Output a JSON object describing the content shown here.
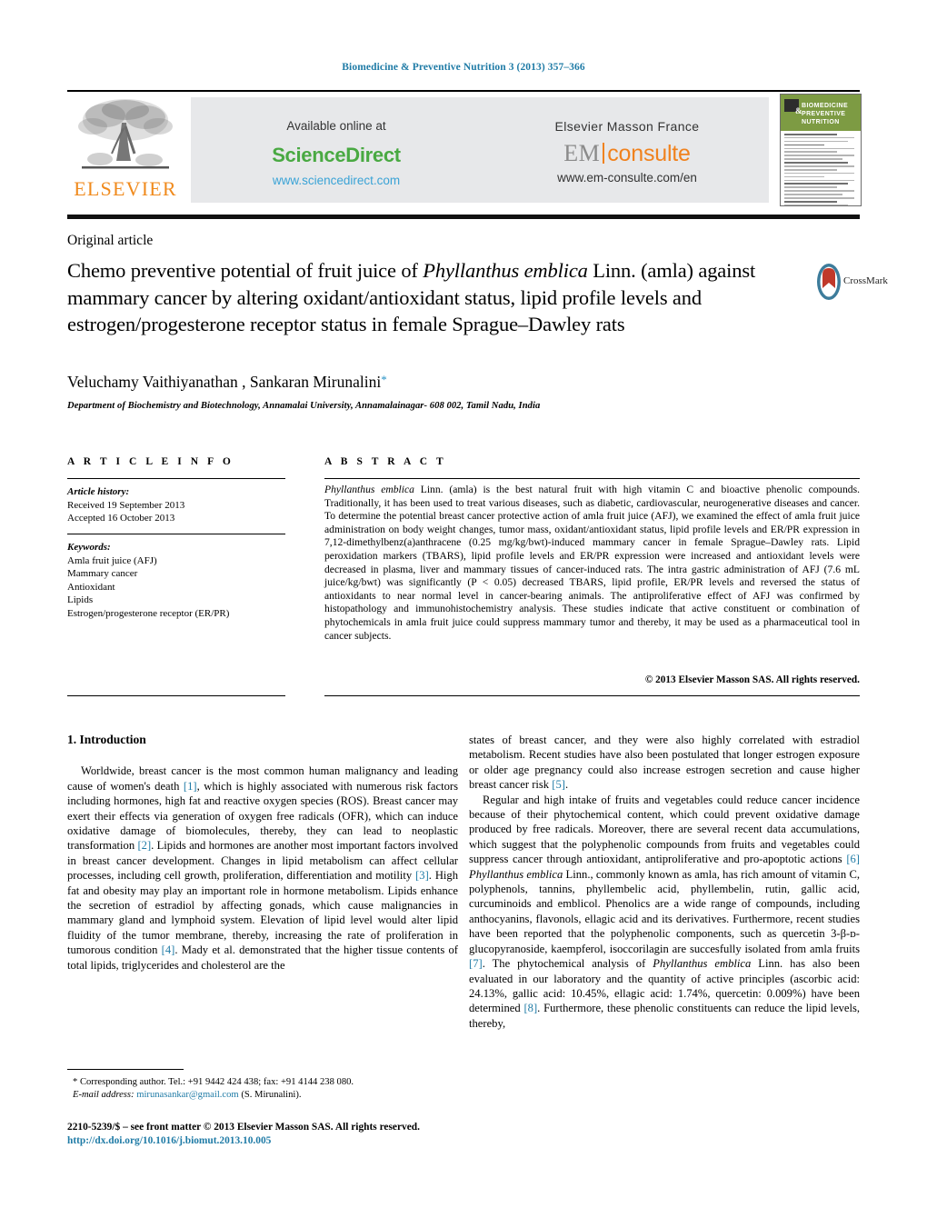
{
  "running_head": "Biomedicine & Preventive Nutrition 3 (2013) 357–366",
  "banner": {
    "publisher_logo_label": "ELSEVIER",
    "available_online": "Available online at",
    "sciencedirect": "ScienceDirect",
    "sciencedirect_url": "www.sciencedirect.com",
    "elsevier_masson": "Elsevier Masson France",
    "emconsulte_em": "EM",
    "emconsulte_consulte": "consulte",
    "emconsulte_url": "www.em-consulte.com/en",
    "cover": {
      "title_line1": "BIOMEDICINE",
      "title_line2": "PREVENTIVE NUTRITION",
      "ampersand": "&"
    }
  },
  "article": {
    "kicker": "Original article",
    "title_part1": "Chemo preventive potential of fruit juice of ",
    "title_italic": "Phyllanthus emblica",
    "title_part2": " Linn. (amla) against mammary cancer by altering oxidant/antioxidant status, lipid profile levels and estrogen/progesterone receptor status in female Sprague–Dawley rats",
    "crossmark_label": "CrossMark",
    "authors": "Veluchamy Vaithiyanathan , Sankaran Mirunalini",
    "corresponding_marker": "*",
    "affiliation": "Department of Biochemistry and Biotechnology, Annamalai University, Annamalainagar- 608 002, Tamil Nadu, India"
  },
  "article_info": {
    "heading": "A R T I C L E   I N F O",
    "history_label": "Article history:",
    "received": "Received 19 September 2013",
    "accepted": "Accepted 16 October 2013",
    "keywords_label": "Keywords:",
    "keywords": [
      "Amla fruit juice (AFJ)",
      "Mammary cancer",
      "Antioxidant",
      "Lipids",
      "Estrogen/progesterone receptor (ER/PR)"
    ]
  },
  "abstract": {
    "heading": "A B S T R A C T",
    "lead_italic": "Phyllanthus emblica",
    "text": " Linn. (amla) is the best natural fruit with high vitamin C and bioactive phenolic compounds. Traditionally, it has been used to treat various diseases, such as diabetic, cardiovascular, neurogenerative diseases and cancer. To determine the potential breast cancer protective action of amla fruit juice (AFJ), we examined the effect of amla fruit juice administration on body weight changes, tumor mass, oxidant/antioxidant status, lipid profile levels and ER/PR expression in 7,12-dimethylbenz(a)anthracene (0.25 mg/kg/bwt)-induced mammary cancer in female Sprague–Dawley rats. Lipid peroxidation markers (TBARS), lipid profile levels and ER/PR expression were increased and antioxidant levels were decreased in plasma, liver and mammary tissues of cancer-induced rats. The intra gastric administration of AFJ (7.6 mL juice/kg/bwt) was significantly (P < 0.05) decreased TBARS, lipid profile, ER/PR levels and reversed the status of antioxidants to near normal level in cancer-bearing animals. The antiproliferative effect of AFJ was confirmed by histopathology and immunohistochemistry analysis. These studies indicate that active constituent or combination of phytochemicals in amla fruit juice could suppress mammary tumor and thereby, it may be used as a pharmaceutical tool in cancer subjects.",
    "copyright": "© 2013 Elsevier Masson SAS. All rights reserved."
  },
  "body": {
    "intro_heading": "1.  Introduction",
    "left_para1_a": "Worldwide, breast cancer is the most common human malignancy and leading cause of women's death ",
    "left_ref1": "[1]",
    "left_para1_b": ", which is highly associated with numerous risk factors including hormones, high fat and reactive oxygen species (ROS). Breast cancer may exert their effects via generation of oxygen free radicals (OFR), which can induce oxidative damage of biomolecules, thereby, they can lead to neoplastic transformation ",
    "left_ref2": "[2]",
    "left_para1_c": ". Lipids and hormones are another most important factors involved in breast cancer development. Changes in lipid metabolism can affect cellular processes, including cell growth, proliferation, differentiation and motility ",
    "left_ref3": "[3]",
    "left_para1_d": ". High fat and obesity may play an important role in hormone metabolism. Lipids enhance the secretion of estradiol by affecting gonads, which cause malignancies in mammary gland and lymphoid system. Elevation of lipid level would alter lipid fluidity of the tumor membrane, thereby, increasing the rate of proliferation in tumorous condition ",
    "left_ref4": "[4]",
    "left_para1_e": ". Mady et al. demonstrated that the higher tissue contents of total lipids, triglycerides and cholesterol are the",
    "right_para1_a": "states of breast cancer, and they were also highly correlated with estradiol metabolism. Recent studies have also been postulated that longer estrogen exposure or older age pregnancy could also increase estrogen secretion and cause higher breast cancer risk ",
    "right_ref5": "[5]",
    "right_para1_b": ".",
    "right_para2_a": "Regular and high intake of fruits and vegetables could reduce cancer incidence because of their phytochemical content, which could prevent oxidative damage produced by free radicals. Moreover, there are several recent data accumulations, which suggest that the polyphenolic compounds from fruits and vegetables could suppress cancer through antioxidant, antiproliferative and pro-apoptotic actions ",
    "right_ref6": "[6]",
    "right_italic1": "Phyllanthus emblica",
    "right_para2_b": " Linn., commonly known as amla, has rich amount of vitamin C, polyphenols, tannins, phyllembelic acid, phyllembelin, rutin, gallic acid, curcuminoids and emblicol. Phenolics are a wide range of compounds, including anthocyanins, flavonols, ellagic acid and its derivatives. Furthermore, recent studies have been reported that the polyphenolic components, such as quercetin 3-β-ᴅ-glucopyranoside, kaempferol, isoccorilagin are succesfully isolated from amla fruits ",
    "right_ref7": "[7]",
    "right_para2_c": ". The phytochemical analysis of ",
    "right_italic2": "Phyllanthus emblica",
    "right_para2_d": " Linn. has also been evaluated in our laboratory and the quantity of active principles (ascorbic acid: 24.13%, gallic acid: 10.45%, ellagic acid: 1.74%, quercetin: 0.009%) have been determined ",
    "right_ref8": "[8]",
    "right_para2_e": ". Furthermore, these phenolic constituents can reduce the lipid levels, thereby,"
  },
  "footer": {
    "corresponding": "* Corresponding author. Tel.: +91 9442 424 438; fax: +91 4144 238 080.",
    "email_label": "E-mail address:",
    "email": "mirunasankar@gmail.com",
    "email_suffix": "(S. Mirunalini).",
    "imprint": "2210-5239/$ – see front matter © 2013 Elsevier Masson SAS. All rights reserved.",
    "doi": "http://dx.doi.org/10.1016/j.biomut.2013.10.005"
  },
  "colors": {
    "link": "#1f7ba6",
    "elsevier_orange": "#f08a1c",
    "sciencedirect_green": "#49a942",
    "emconsulte_orange": "#f0821e",
    "cover_green": "#7d9b43",
    "band_gray": "#e7e8ea"
  }
}
